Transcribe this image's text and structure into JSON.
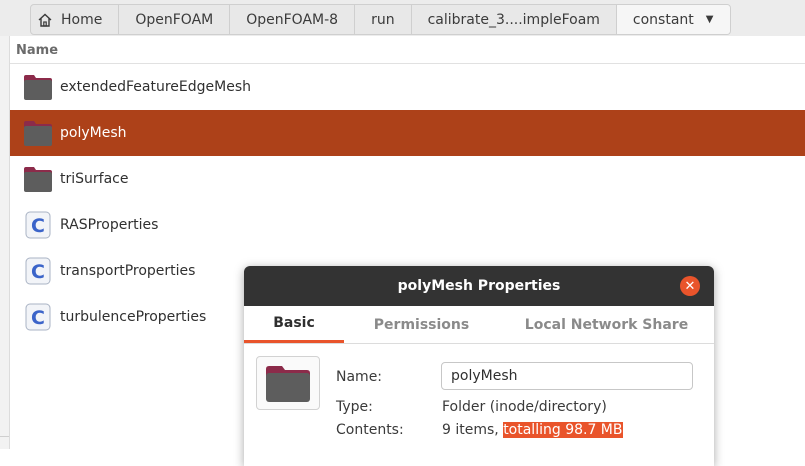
{
  "breadcrumb": {
    "home": "Home",
    "items": [
      "OpenFOAM",
      "OpenFOAM-8",
      "run",
      "calibrate_3....impleFoam",
      "constant"
    ]
  },
  "column_header": "Name",
  "files": [
    {
      "name": "extendedFeatureEdgeMesh",
      "type": "folder"
    },
    {
      "name": "polyMesh",
      "type": "folder",
      "selected": true
    },
    {
      "name": "triSurface",
      "type": "folder"
    },
    {
      "name": "RASProperties",
      "type": "c-file"
    },
    {
      "name": "transportProperties",
      "type": "c-file"
    },
    {
      "name": "turbulenceProperties",
      "type": "c-file"
    }
  ],
  "dialog": {
    "title": "polyMesh Properties",
    "tabs": [
      "Basic",
      "Permissions",
      "Local Network Share"
    ],
    "active_tab": "Basic",
    "name_label": "Name:",
    "name_value": "polyMesh",
    "type_label": "Type:",
    "type_value": "Folder (inode/directory)",
    "contents_label": "Contents:",
    "contents_count": "9 items,",
    "contents_total": "totalling 98.7 MB"
  },
  "colors": {
    "selection": "#ad4119",
    "accent": "#e9542b",
    "titlebar": "#333333"
  },
  "icons": {
    "home": "home-icon",
    "folder": "folder-icon",
    "c_file": "c-source-file-icon",
    "dropdown": "chevron-down-icon",
    "close": "close-icon"
  }
}
